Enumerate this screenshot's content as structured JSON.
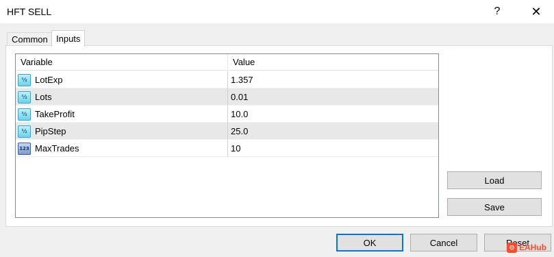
{
  "window": {
    "title": "HFT SELL",
    "help_label": "?",
    "close_label": "✕"
  },
  "tabs": [
    {
      "label": "Common"
    },
    {
      "label": "Inputs"
    }
  ],
  "table": {
    "headers": [
      "Variable",
      "Value"
    ],
    "rows": [
      {
        "icon": "half-icon",
        "icon_text": "½",
        "variable": "LotExp",
        "value": "1.357"
      },
      {
        "icon": "half-icon",
        "icon_text": "½",
        "variable": "Lots",
        "value": "0.01"
      },
      {
        "icon": "half-icon",
        "icon_text": "½",
        "variable": "TakeProfit",
        "value": "10.0"
      },
      {
        "icon": "half-icon",
        "icon_text": "½",
        "variable": "PipStep",
        "value": "25.0"
      },
      {
        "icon": "integer-icon",
        "icon_text": "123",
        "variable": "MaxTrades",
        "value": "10"
      }
    ]
  },
  "buttons": {
    "load": "Load",
    "save": "Save",
    "ok": "OK",
    "cancel": "Cancel",
    "reset": "Reset"
  },
  "watermark": {
    "text": "EAHub"
  },
  "colors": {
    "focus_border": "#0078d7",
    "row_alt": "#e8e8e8",
    "watermark": "#ff4b2b"
  }
}
